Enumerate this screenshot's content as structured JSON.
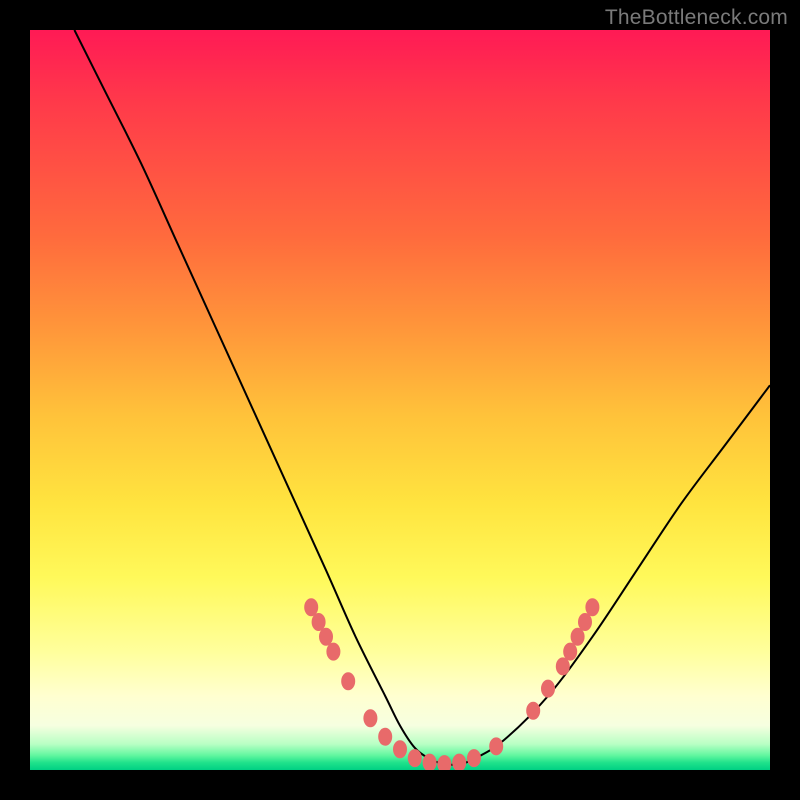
{
  "watermark": "TheBottleneck.com",
  "chart_data": {
    "type": "line",
    "title": "",
    "xlabel": "",
    "ylabel": "",
    "xlim": [
      0,
      100
    ],
    "ylim": [
      0,
      100
    ],
    "grid": false,
    "legend": false,
    "series": [
      {
        "name": "curve",
        "color": "#000000",
        "x": [
          6,
          10,
          15,
          20,
          25,
          30,
          35,
          40,
          44,
          48,
          50,
          52,
          54,
          56,
          58,
          60,
          64,
          70,
          76,
          82,
          88,
          94,
          100
        ],
        "y": [
          100,
          92,
          82,
          71,
          60,
          49,
          38,
          27,
          18,
          10,
          6,
          3,
          1.5,
          0.8,
          0.8,
          1.5,
          4,
          10,
          18,
          27,
          36,
          44,
          52
        ]
      }
    ],
    "markers": {
      "name": "highlighted-points",
      "color": "#e86a6a",
      "points": [
        {
          "x": 38,
          "y": 22
        },
        {
          "x": 39,
          "y": 20
        },
        {
          "x": 40,
          "y": 18
        },
        {
          "x": 41,
          "y": 16
        },
        {
          "x": 43,
          "y": 12
        },
        {
          "x": 46,
          "y": 7
        },
        {
          "x": 48,
          "y": 4.5
        },
        {
          "x": 50,
          "y": 2.8
        },
        {
          "x": 52,
          "y": 1.6
        },
        {
          "x": 54,
          "y": 1.0
        },
        {
          "x": 56,
          "y": 0.8
        },
        {
          "x": 58,
          "y": 1.0
        },
        {
          "x": 60,
          "y": 1.6
        },
        {
          "x": 63,
          "y": 3.2
        },
        {
          "x": 68,
          "y": 8
        },
        {
          "x": 70,
          "y": 11
        },
        {
          "x": 72,
          "y": 14
        },
        {
          "x": 73,
          "y": 16
        },
        {
          "x": 74,
          "y": 18
        },
        {
          "x": 75,
          "y": 20
        },
        {
          "x": 76,
          "y": 22
        }
      ]
    },
    "background_gradient": {
      "top": "#ff1a55",
      "upper_mid": "#ff953a",
      "mid": "#ffe43f",
      "lower_mid": "#ffffd0",
      "bottom": "#00d084"
    }
  }
}
